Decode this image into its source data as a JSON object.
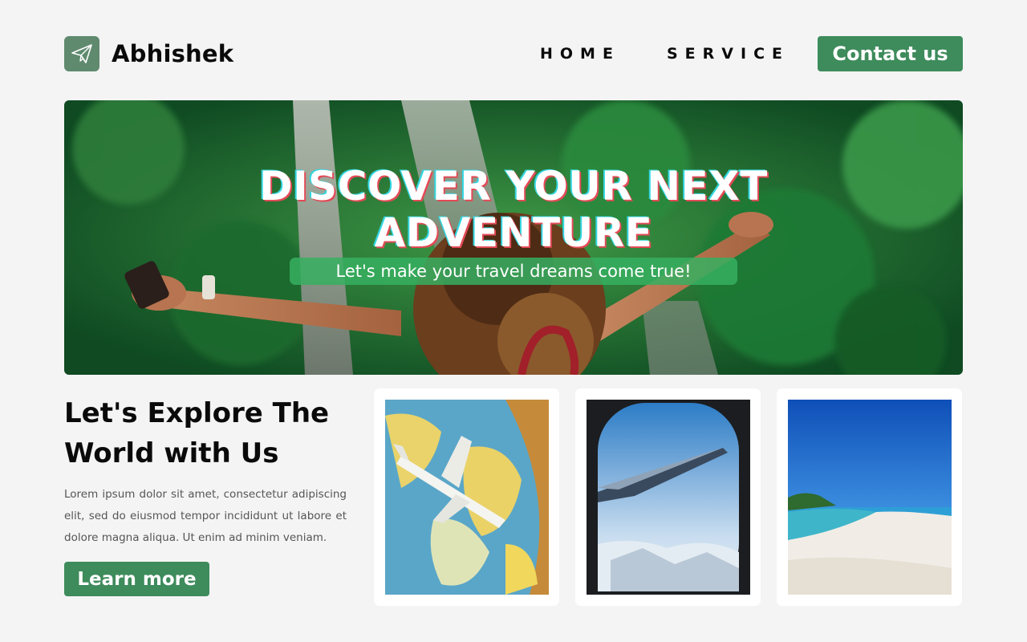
{
  "header": {
    "brand": "Abhishek",
    "logo_icon": "paper-plane-icon",
    "nav": [
      "HOME",
      "SERVICE"
    ],
    "contact_label": "Contact us"
  },
  "hero": {
    "title_line1": "DISCOVER YOUR NEXT",
    "title_line2": "ADVENTURE",
    "subtitle": "Let's make your travel dreams come true!"
  },
  "explore": {
    "title_line1": "Let's Explore The",
    "title_line2": "World with Us",
    "description": "Lorem ipsum dolor sit amet, consectetur adipiscing elit, sed do eiusmod tempor incididunt ut labore et dolore magna aliqua. Ut enim ad minim veniam.",
    "button_label": "Learn more"
  },
  "colors": {
    "accent_green": "#3e8b5c",
    "logo_badge": "#5f8a6e",
    "page_background": "#f4f4f4"
  }
}
